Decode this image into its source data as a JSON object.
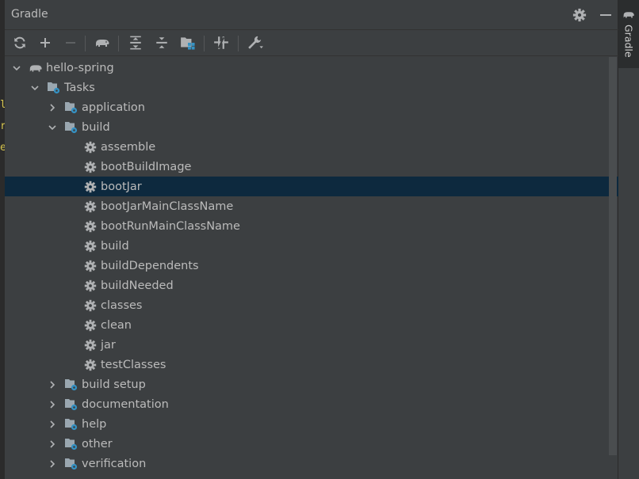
{
  "editor_gutter": {
    "glyphs": [
      "l",
      "r",
      "e"
    ]
  },
  "header": {
    "title": "Gradle"
  },
  "toolbar": {
    "buttons": [
      "reload-all",
      "link-project",
      "unlink-project",
      "execute-task",
      "expand-all",
      "collapse-all",
      "group-modules",
      "toggle-offline",
      "build-settings"
    ]
  },
  "tree": {
    "root": "hello-spring",
    "tasks": "Tasks",
    "application": "application",
    "build": "build",
    "build_tasks": [
      "assemble",
      "bootBuildImage",
      "bootJar",
      "bootJarMainClassName",
      "bootRunMainClassName",
      "build",
      "buildDependents",
      "buildNeeded",
      "classes",
      "clean",
      "jar",
      "testClasses"
    ],
    "groups_after": [
      "build setup",
      "documentation",
      "help",
      "other",
      "verification"
    ],
    "selected": "bootJar"
  },
  "side_tab": {
    "label": "Gradle"
  },
  "colors": {
    "panel_bg": "#3c3f41",
    "selection_bg": "#0d293e",
    "text": "#bbbbbb",
    "icon_gray": "#afb1b3",
    "accent_blue": "#3592c4"
  }
}
